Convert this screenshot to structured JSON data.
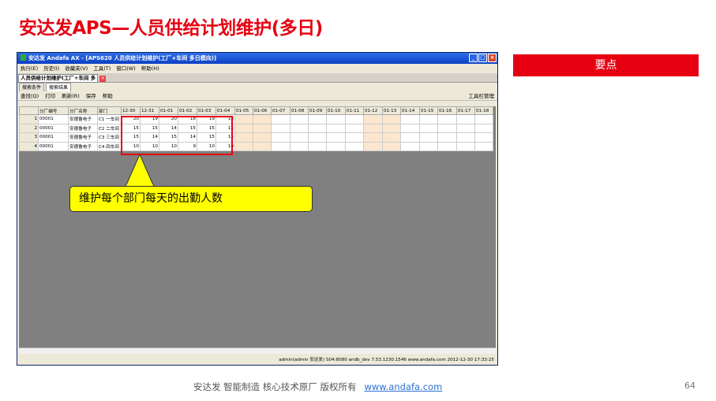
{
  "slide": {
    "title": "安达发APS—人员供给计划维护(多日)",
    "keypoint": "要点",
    "footer_text": "安达发   智能制造 核心技术原厂   版权所有",
    "footer_link": "www.andafa.com",
    "page_number": "64",
    "accent_color": "#e60012"
  },
  "window": {
    "title": "安达发 Andafa AX - [APS620 人员供给计划维护(工厂+车间 多日模向)]",
    "menu": [
      "执行(E)",
      "历史(I)",
      "收藏夹(V)",
      "工具(T)",
      "窗口(W)",
      "帮助(H)"
    ],
    "doc_tab": "人员供给计划维护(工厂+车间 多",
    "subtabs": [
      "搜索条件",
      "搜索结果"
    ],
    "toolbar": {
      "query": "查找(Q)",
      "print": "打印",
      "refresh": "刷新(R)",
      "save": "保存",
      "help": "帮助",
      "tools": "工具栏管理"
    },
    "status": "admin(admin 安达发)  S04:8080  andb_dev  7.53.1230.1546  www.andafa.com  2012-12-30 17:33:25"
  },
  "grid": {
    "headers": [
      "分厂编号",
      "分厂名称",
      "部门",
      "12-30",
      "12-31",
      "01-01",
      "01-02",
      "01-03",
      "01-04",
      "01-05",
      "01-06",
      "01-07",
      "01-08",
      "01-09",
      "01-10",
      "01-11",
      "01-12",
      "01-13",
      "01-14",
      "01-15",
      "01-16",
      "01-17",
      "01-18"
    ],
    "rows": [
      {
        "n": "1",
        "code": "00001",
        "name": "安德鲁电子",
        "dept": "C1 一车间",
        "v": [
          "20",
          "19",
          "20",
          "18",
          "19",
          "18"
        ]
      },
      {
        "n": "2",
        "code": "00001",
        "name": "安德鲁电子",
        "dept": "C2 二车间",
        "v": [
          "15",
          "15",
          "14",
          "15",
          "15",
          "15"
        ]
      },
      {
        "n": "3",
        "code": "00001",
        "name": "安德鲁电子",
        "dept": "C3 三车间",
        "v": [
          "15",
          "14",
          "15",
          "14",
          "15",
          "15"
        ]
      },
      {
        "n": "4",
        "code": "00001",
        "name": "安德鲁电子",
        "dept": "C4 四车间",
        "v": [
          "10",
          "10",
          "10",
          "9",
          "10",
          "10"
        ]
      }
    ]
  },
  "callout": "维护每个部门每天的出勤人数"
}
